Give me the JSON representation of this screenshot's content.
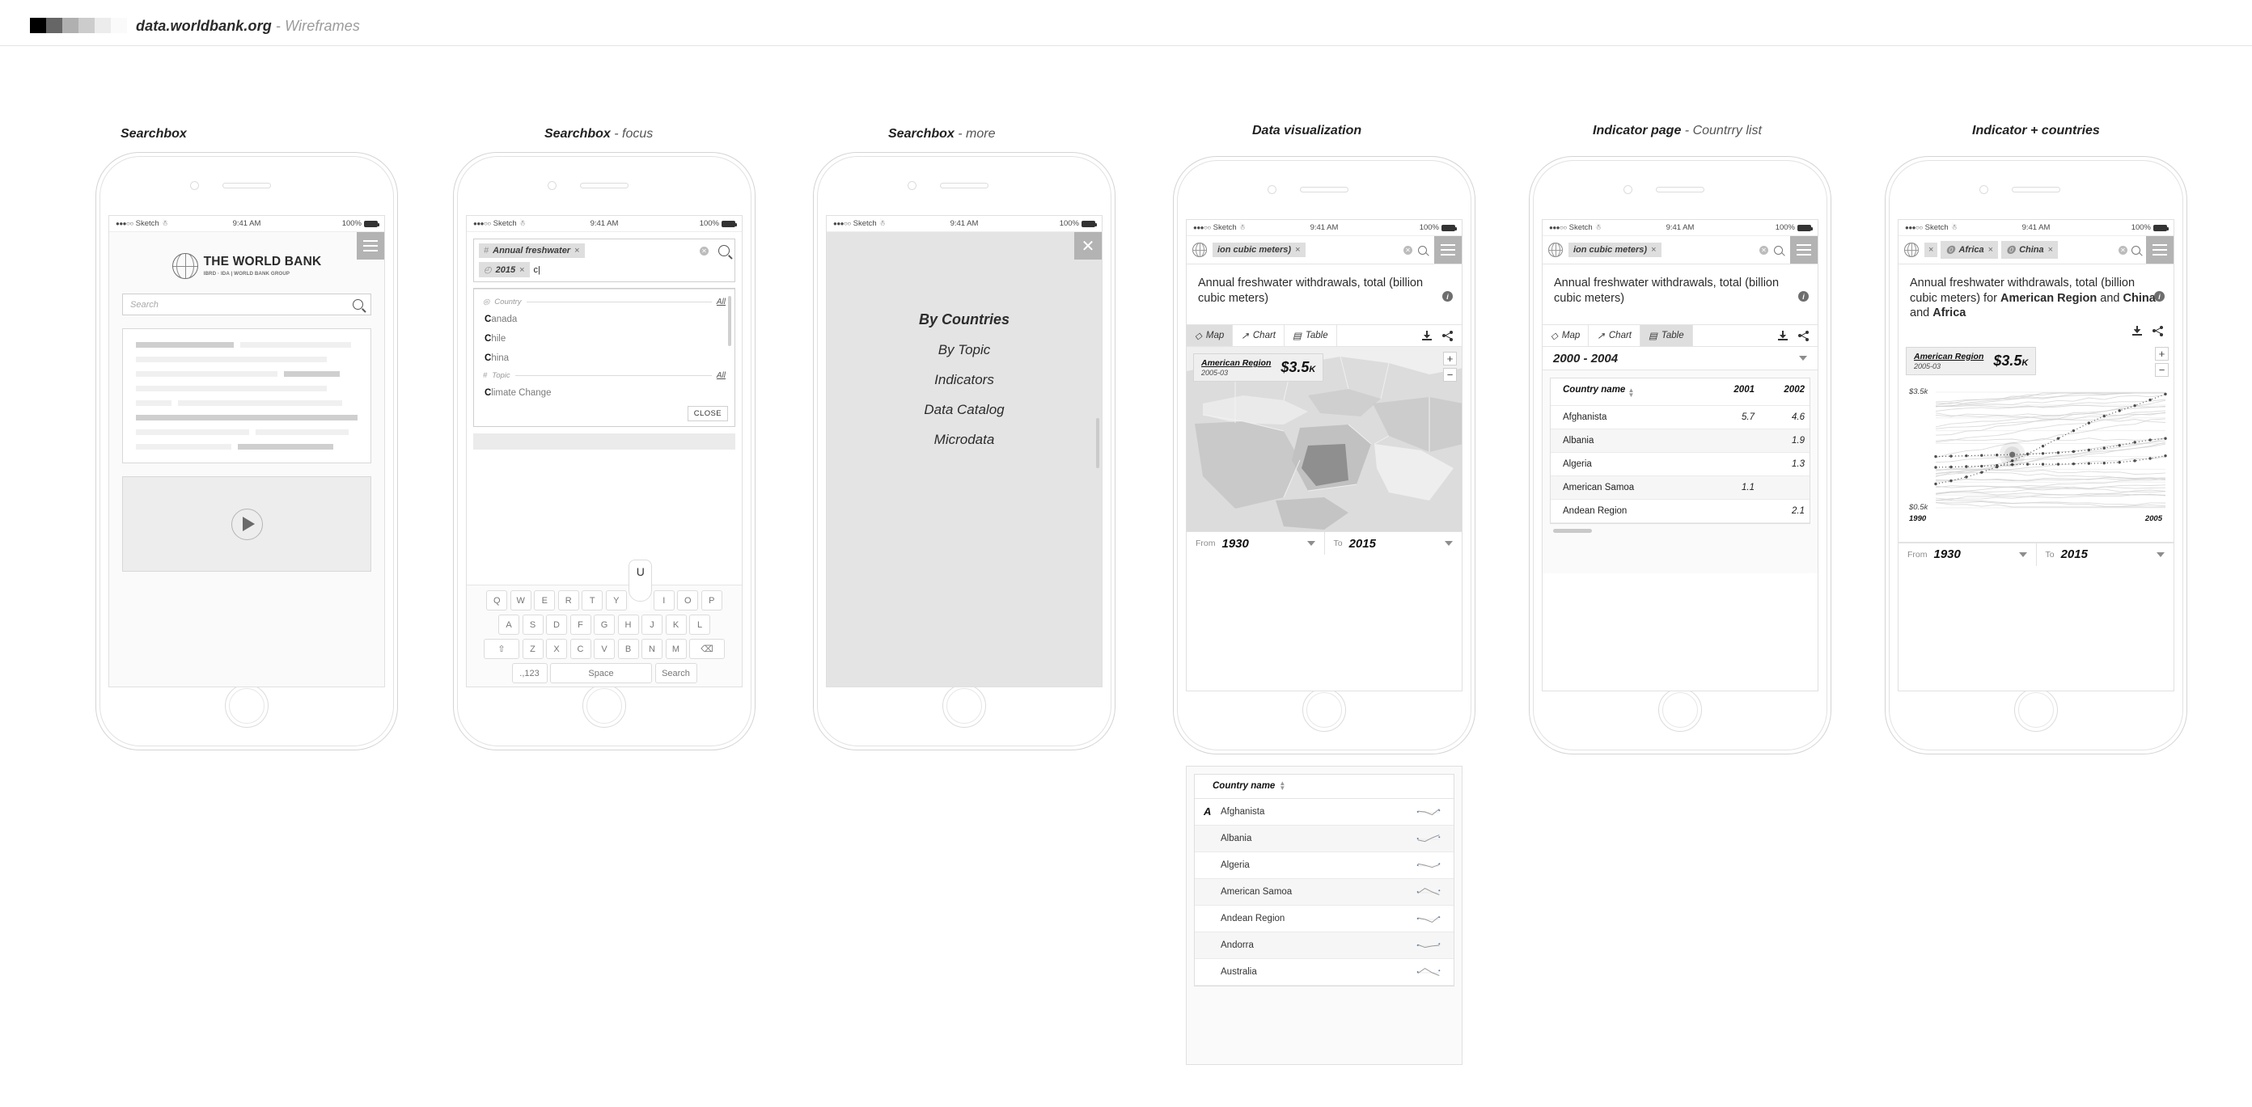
{
  "topbar": {
    "title": "data.worldbank.org",
    "subtitle": " - Wireframes",
    "swatches": [
      "#000000",
      "#666666",
      "#b0b0b0",
      "#cccccc",
      "#ececec",
      "#fafafa"
    ]
  },
  "status_bar": {
    "carrier_dots": "●●●○○",
    "carrier": "Sketch",
    "wifi_icon": "wifi-icon",
    "time": "9:41 AM",
    "battery_pct": "100%"
  },
  "captions": {
    "p1": "Searchbox",
    "p2_main": "Searchbox",
    "p2_sub": " - focus",
    "p3_main": "Searchbox",
    "p3_sub": " - more",
    "p4": "Data visualization",
    "p5_main": "Indicator page",
    "p5_sub": " - Countrry list",
    "p6": "Indicator + countries"
  },
  "phone1": {
    "menu_icon": "hamburger-icon",
    "logo": {
      "icon": "globe-logo-icon",
      "name": "THE WORLD BANK",
      "sub": "IBRD · IDA  |  WORLD BANK GROUP"
    },
    "search": {
      "placeholder": "Search",
      "icon": "search-icon"
    },
    "video": {
      "icon": "play-icon"
    }
  },
  "phone2": {
    "chips": [
      {
        "prefix": "#",
        "label": "Annual freshwater",
        "close": "×"
      },
      {
        "prefix": "◴",
        "label": "2015",
        "close": "×"
      }
    ],
    "typed_text": "c",
    "clear_icon": "clear-circle-icon",
    "search_icon": "search-icon",
    "groups": [
      {
        "icon": "location-pin-icon",
        "title": "Country",
        "all": "All",
        "items": [
          {
            "bold": "C",
            "rest": "anada"
          },
          {
            "bold": "C",
            "rest": "hile"
          },
          {
            "bold": "C",
            "rest": "hina"
          }
        ]
      },
      {
        "icon": "hash-icon",
        "title": "Topic",
        "all": "All",
        "items": [
          {
            "bold": "C",
            "rest": "limate Change"
          }
        ]
      }
    ],
    "close_label": "CLOSE",
    "keyboard": {
      "popup_key": "U",
      "row1": [
        "Q",
        "W",
        "E",
        "R",
        "T",
        "Y",
        "U",
        "I",
        "O",
        "P"
      ],
      "row2": [
        "A",
        "S",
        "D",
        "F",
        "G",
        "H",
        "J",
        "K",
        "L"
      ],
      "row3": [
        "⇧",
        "Z",
        "X",
        "C",
        "V",
        "B",
        "N",
        "M",
        "⌫"
      ],
      "row4": [
        ".,123",
        "Space",
        "Search"
      ]
    }
  },
  "phone3": {
    "close_icon": "close-icon",
    "menu": [
      "By Countries",
      "By Topic",
      "Indicators",
      "Data Catalog",
      "Microdata"
    ]
  },
  "phone4": {
    "chip": {
      "label": "ion cubic meters)",
      "close": "×"
    },
    "clear_icon": "clear-circle-icon",
    "search_icon": "search-icon",
    "menu_icon": "hamburger-icon",
    "info_icon": "info-icon",
    "title": "Annual freshwater withdrawals, total (billion cubic meters)",
    "tabs": [
      {
        "label": "Map",
        "icon": "layers-icon",
        "active": true
      },
      {
        "label": "Chart",
        "icon": "chart-line-icon",
        "active": false
      },
      {
        "label": "Table",
        "icon": "table-grid-icon",
        "active": false
      }
    ],
    "download_icon": "download-icon",
    "share_icon": "share-icon",
    "tooltip": {
      "name": "American Region",
      "date": "2005-03",
      "value": "$3.5",
      "unit": "K"
    },
    "zoom_in": "+",
    "zoom_out": "−",
    "range": {
      "from_label": "From",
      "from_value": "1930",
      "to_label": "To",
      "to_value": "2015"
    },
    "list": {
      "header": "Country name",
      "rows": [
        {
          "az": "A",
          "name": "Afghanista"
        },
        {
          "az": "",
          "name": "Albania"
        },
        {
          "az": "",
          "name": "Algeria"
        },
        {
          "az": "",
          "name": "American Samoa"
        },
        {
          "az": "",
          "name": "Andean Region"
        },
        {
          "az": "",
          "name": "Andorra"
        },
        {
          "az": "",
          "name": "Australia"
        }
      ]
    }
  },
  "phone5": {
    "chip": {
      "label": "ion cubic meters)",
      "close": "×"
    },
    "title": "Annual freshwater withdrawals, total (billion cubic meters)",
    "tabs": [
      {
        "label": "Map",
        "icon": "layers-icon",
        "active": false
      },
      {
        "label": "Chart",
        "icon": "chart-line-icon",
        "active": false
      },
      {
        "label": "Table",
        "icon": "table-grid-icon",
        "active": true
      }
    ],
    "period": "2000 - 2004",
    "table": {
      "columns": [
        "Country name",
        "2001",
        "2002"
      ],
      "rows": [
        {
          "name": "Afghanista",
          "v2001": "5.7",
          "v2002": "4.6"
        },
        {
          "name": "Albania",
          "v2001": "",
          "v2002": "1.9"
        },
        {
          "name": "Algeria",
          "v2001": "",
          "v2002": "1.3"
        },
        {
          "name": "American Samoa",
          "v2001": "1.1",
          "v2002": ""
        },
        {
          "name": "Andean Region",
          "v2001": "",
          "v2002": "2.1"
        }
      ]
    }
  },
  "phone6": {
    "chips": [
      {
        "prefix": "",
        "label": "",
        "close": "×"
      },
      {
        "prefix": "⓿",
        "label": "Africa",
        "close": "×"
      },
      {
        "prefix": "⓿",
        "label": "China",
        "close": "×"
      }
    ],
    "title_plain": "Annual freshwater withdrawals, total (billion cubic meters) for ",
    "title_bold1": "American Region",
    "title_mid1": " and ",
    "title_bold2": "China",
    "title_mid2": " and ",
    "title_bold3": "Africa",
    "tooltip": {
      "name": "American Region",
      "date": "2005-03",
      "value": "$3.5",
      "unit": "K"
    },
    "range": {
      "from_label": "From",
      "from_value": "1930",
      "to_label": "To",
      "to_value": "2015"
    },
    "chart_data": {
      "type": "line",
      "title": "Annual freshwater withdrawals, total (billion cubic meters)",
      "xlabel": "",
      "ylabel": "",
      "x": [
        1990,
        1991,
        1992,
        1993,
        1994,
        1995,
        1996,
        1997,
        1998,
        1999,
        2000,
        2001,
        2002,
        2003,
        2004,
        2005
      ],
      "xlim": [
        1990,
        2005
      ],
      "ylim": [
        0.5,
        3.5
      ],
      "y_tick_labels": [
        "$3.5k",
        "$0.5k"
      ],
      "x_tick_labels": [
        "1990",
        "2005"
      ],
      "grid": true,
      "legend": "none",
      "series": [
        {
          "name": "American Region",
          "highlight": true,
          "values": [
            1.83,
            1.84,
            1.85,
            1.86,
            1.87,
            1.88,
            1.89,
            1.91,
            1.93,
            1.96,
            2.0,
            2.05,
            2.12,
            2.2,
            2.26,
            2.3
          ]
        },
        {
          "name": "China",
          "highlight": true,
          "values": [
            1.55,
            1.56,
            1.57,
            1.58,
            1.6,
            1.62,
            1.63,
            1.63,
            1.63,
            1.64,
            1.65,
            1.66,
            1.68,
            1.72,
            1.78,
            1.85
          ]
        },
        {
          "name": "Africa",
          "highlight": true,
          "values": [
            1.12,
            1.2,
            1.3,
            1.42,
            1.56,
            1.72,
            1.9,
            2.1,
            2.3,
            2.5,
            2.7,
            2.88,
            3.02,
            3.15,
            3.3,
            3.45
          ]
        }
      ],
      "background_series_count": 34,
      "hover_point": {
        "x": 1995,
        "y": 1.88,
        "label": "$3.5K",
        "series": "American Region"
      }
    }
  }
}
